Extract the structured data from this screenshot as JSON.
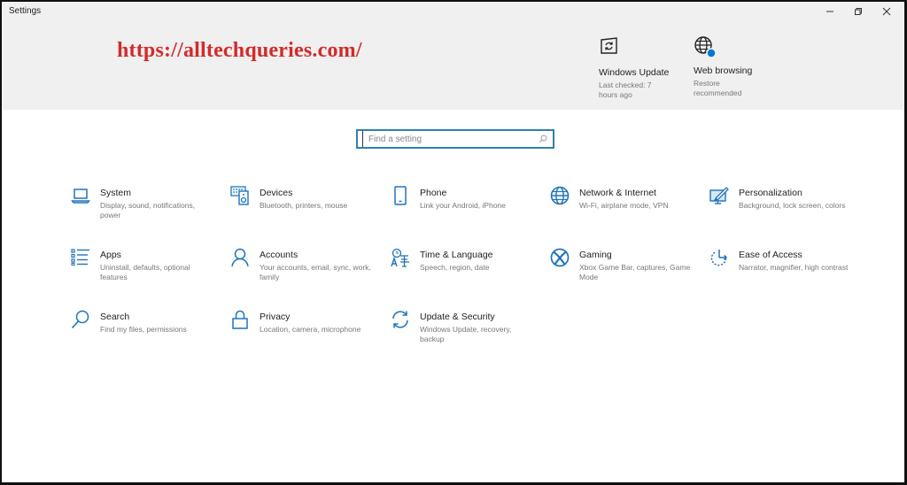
{
  "window": {
    "title": "Settings",
    "controls": {
      "minimize": "minimize",
      "restore": "restore",
      "close": "close"
    }
  },
  "watermark": "https://alltechqueries.com/",
  "quick_links": [
    {
      "title": "Windows Update",
      "subtitle": "Last checked: 7 hours ago",
      "icon": "windows-update-icon"
    },
    {
      "title": "Web browsing",
      "subtitle": "Restore recommended",
      "icon": "globe-badge-icon",
      "badge_color": "#0078d7"
    }
  ],
  "search": {
    "placeholder": "Find a setting",
    "value": ""
  },
  "accent_color": "#1e73be",
  "categories": [
    {
      "name": "System",
      "desc": "Display, sound, notifications, power",
      "icon": "laptop-icon"
    },
    {
      "name": "Devices",
      "desc": "Bluetooth, printers, mouse",
      "icon": "devices-icon"
    },
    {
      "name": "Phone",
      "desc": "Link your Android, iPhone",
      "icon": "phone-icon"
    },
    {
      "name": "Network & Internet",
      "desc": "Wi-Fi, airplane mode, VPN",
      "icon": "globe-icon"
    },
    {
      "name": "Personalization",
      "desc": "Background, lock screen, colors",
      "icon": "personalization-icon"
    },
    {
      "name": "Apps",
      "desc": "Uninstall, defaults, optional features",
      "icon": "apps-list-icon"
    },
    {
      "name": "Accounts",
      "desc": "Your accounts, email, sync, work, family",
      "icon": "person-icon"
    },
    {
      "name": "Time & Language",
      "desc": "Speech, region, date",
      "icon": "time-language-icon"
    },
    {
      "name": "Gaming",
      "desc": "Xbox Game Bar, captures, Game Mode",
      "icon": "xbox-icon"
    },
    {
      "name": "Ease of Access",
      "desc": "Narrator, magnifier, high contrast",
      "icon": "ease-of-access-icon"
    },
    {
      "name": "Search",
      "desc": "Find my files, permissions",
      "icon": "search-icon"
    },
    {
      "name": "Privacy",
      "desc": "Location, camera, microphone",
      "icon": "lock-icon"
    },
    {
      "name": "Update & Security",
      "desc": "Windows Update, recovery, backup",
      "icon": "sync-icon"
    }
  ]
}
